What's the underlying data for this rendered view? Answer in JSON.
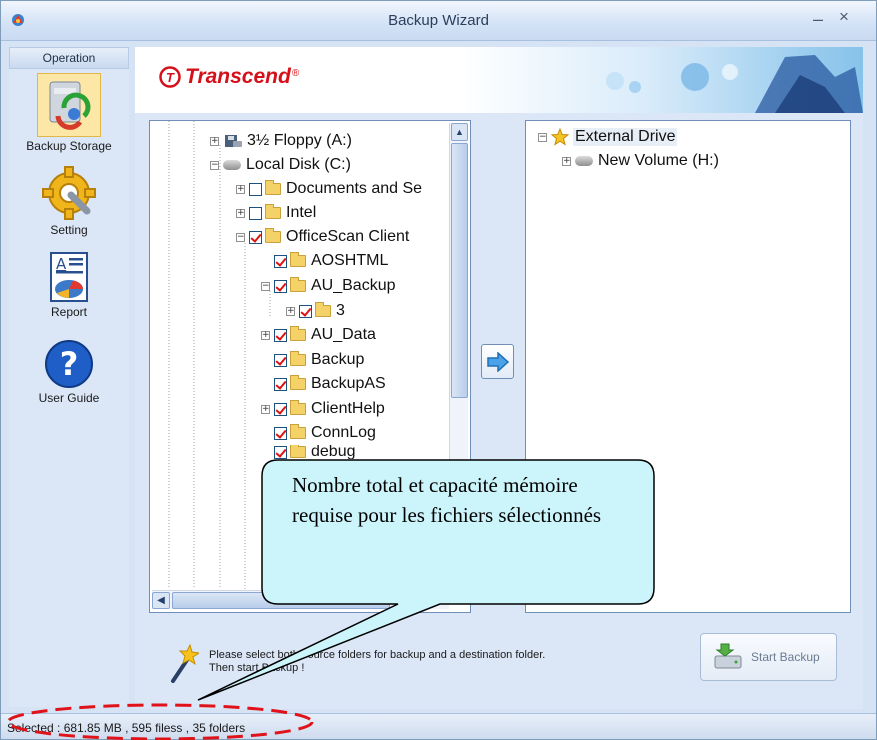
{
  "window": {
    "title": "Backup Wizard",
    "minimize": "–",
    "close": "×"
  },
  "sidebar": {
    "header": "Operation",
    "items": [
      {
        "label": "Backup Storage",
        "icon": "backup-storage-icon"
      },
      {
        "label": "Setting",
        "icon": "gear-wrench-icon"
      },
      {
        "label": "Report",
        "icon": "report-icon"
      },
      {
        "label": "User Guide",
        "icon": "help-icon"
      }
    ]
  },
  "banner": {
    "logo": "Transcend",
    "logo_mark": "®"
  },
  "source_tree": [
    {
      "label": "3½ Floppy (A:)",
      "expander": "+",
      "icon": "floppy-icon",
      "checkbox": null
    },
    {
      "label": "Local Disk (C:)",
      "expander": "−",
      "icon": "drive-icon",
      "checkbox": null
    },
    {
      "label": "Documents and Se",
      "expander": "+",
      "icon": "folder-icon",
      "checkbox": "off"
    },
    {
      "label": "Intel",
      "expander": "+",
      "icon": "folder-icon",
      "checkbox": "off"
    },
    {
      "label": "OfficeScan Client",
      "expander": "−",
      "icon": "folder-icon",
      "checkbox": "on"
    },
    {
      "label": "AOSHTML",
      "expander": null,
      "icon": "folder-icon",
      "checkbox": "on"
    },
    {
      "label": "AU_Backup",
      "expander": "−",
      "icon": "folder-icon",
      "checkbox": "on"
    },
    {
      "label": "3",
      "expander": "+",
      "icon": "folder-icon",
      "checkbox": "on"
    },
    {
      "label": "AU_Data",
      "expander": "+",
      "icon": "folder-icon",
      "checkbox": "on"
    },
    {
      "label": "Backup",
      "expander": null,
      "icon": "folder-icon",
      "checkbox": "on"
    },
    {
      "label": "BackupAS",
      "expander": null,
      "icon": "folder-icon",
      "checkbox": "on"
    },
    {
      "label": "ClientHelp",
      "expander": "+",
      "icon": "folder-icon",
      "checkbox": "on"
    },
    {
      "label": "ConnLog",
      "expander": null,
      "icon": "folder-icon",
      "checkbox": "on"
    },
    {
      "label": "debug",
      "expander": null,
      "icon": "folder-icon",
      "checkbox": "on"
    }
  ],
  "dest_tree": [
    {
      "label": "External Drive",
      "expander": "−",
      "icon": "star-icon"
    },
    {
      "label": "New Volume (H:)",
      "expander": "+",
      "icon": "drive-icon"
    }
  ],
  "hint": "Please select both source folders for backup and a destination folder. Then start Backup !",
  "start_button": "Start Backup",
  "status": "Selected : 681.85 MB , 595 filess , 35 folders",
  "callout": "Nombre total et capacité mémoire requise pour les fichiers sélectionnés",
  "colors": {
    "accent_red": "#e0121a",
    "callout_fill": "#ccf5fb",
    "window_bg": "#d5e3f5"
  }
}
